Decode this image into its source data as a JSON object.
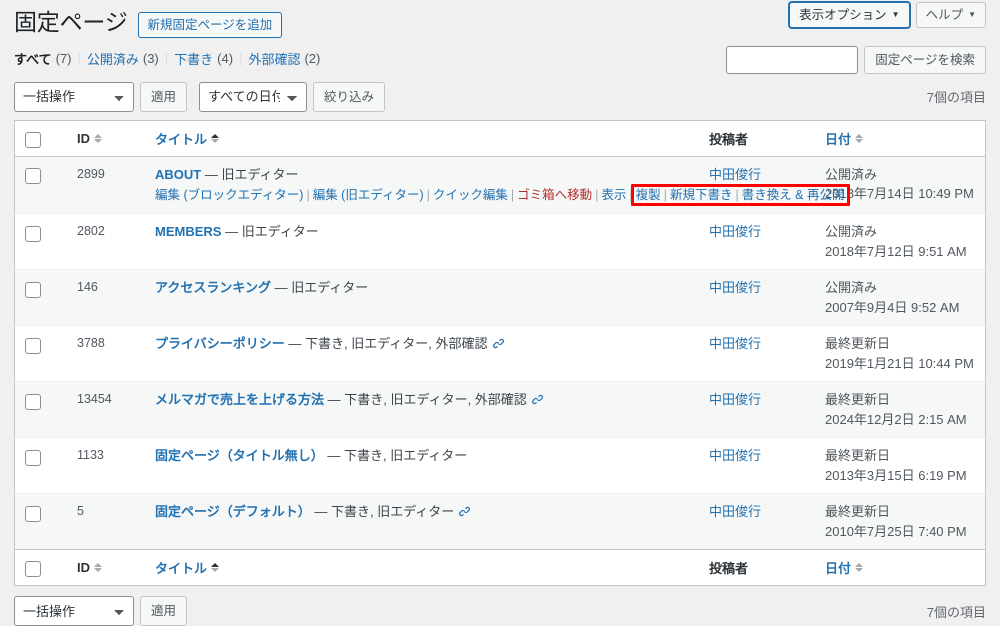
{
  "screen_meta": {
    "show_options_label": "表示オプション",
    "help_label": "ヘルプ",
    "caret": "▼"
  },
  "header": {
    "title": "固定ページ",
    "add_new_label": "新規固定ページを追加"
  },
  "status_filters": [
    {
      "label": "すべて",
      "count": "(7)",
      "current": true
    },
    {
      "label": "公開済み",
      "count": "(3)",
      "current": false
    },
    {
      "label": "下書き",
      "count": "(4)",
      "current": false
    },
    {
      "label": "外部確認",
      "count": "(2)",
      "current": false
    }
  ],
  "search": {
    "value": "",
    "placeholder": "",
    "submit_label": "固定ページを検索"
  },
  "tablenav_top": {
    "bulk_action_selected": "一括操作",
    "apply_label": "適用",
    "date_filter_selected": "すべての日付",
    "filter_label": "絞り込み",
    "displaying_num": "7個の項目"
  },
  "tablenav_bottom": {
    "bulk_action_selected": "一括操作",
    "apply_label": "適用",
    "displaying_num": "7個の項目"
  },
  "table_headers": {
    "id": "ID",
    "title": "タイトル",
    "author": "投稿者",
    "date": "日付"
  },
  "highlight": {
    "color": "#ff0000",
    "note": "複製 | 新規下書き | 書き換え & 再公開"
  },
  "colors": {
    "link": "#2271b1",
    "trash_link": "#b32d2e",
    "highlight": "#ff0000",
    "row_alt_bg": "#f6f7f7",
    "page_bg": "#f0f0f1"
  },
  "rows": [
    {
      "id": "2899",
      "title": "ABOUT",
      "state": "— 旧エディター",
      "has_link_icon": false,
      "author": "中田俊行",
      "date_status": "公開済み",
      "date_value": "2018年7月14日 10:49 PM",
      "actions": [
        {
          "label": "編集 (ブロックエディター)",
          "kind": "link"
        },
        {
          "label": "編集 (旧エディター)",
          "kind": "link"
        },
        {
          "label": "クイック編集",
          "kind": "link"
        },
        {
          "label": "ゴミ箱へ移動",
          "kind": "trash"
        },
        {
          "label": "表示",
          "kind": "link"
        },
        {
          "label": "複製",
          "kind": "link"
        },
        {
          "label": "新規下書き",
          "kind": "link"
        },
        {
          "label": "書き換え & 再公開",
          "kind": "link"
        }
      ]
    },
    {
      "id": "2802",
      "title": "MEMBERS",
      "state": "— 旧エディター",
      "has_link_icon": false,
      "author": "中田俊行",
      "date_status": "公開済み",
      "date_value": "2018年7月12日 9:51 AM",
      "actions": []
    },
    {
      "id": "146",
      "title": "アクセスランキング",
      "state": "— 旧エディター",
      "has_link_icon": false,
      "author": "中田俊行",
      "date_status": "公開済み",
      "date_value": "2007年9月4日 9:52 AM",
      "actions": []
    },
    {
      "id": "3788",
      "title": "プライバシーポリシー",
      "state": "— 下書き, 旧エディター, 外部確認",
      "has_link_icon": true,
      "author": "中田俊行",
      "date_status": "最終更新日",
      "date_value": "2019年1月21日 10:44 PM",
      "actions": []
    },
    {
      "id": "13454",
      "title": "メルマガで売上を上げる方法",
      "state": "— 下書き, 旧エディター, 外部確認",
      "has_link_icon": true,
      "author": "中田俊行",
      "date_status": "最終更新日",
      "date_value": "2024年12月2日 2:15 AM",
      "actions": []
    },
    {
      "id": "1133",
      "title": "固定ページ（タイトル無し）",
      "state": "— 下書き, 旧エディター",
      "has_link_icon": false,
      "author": "中田俊行",
      "date_status": "最終更新日",
      "date_value": "2013年3月15日 6:19 PM",
      "actions": []
    },
    {
      "id": "5",
      "title": "固定ページ（デフォルト）",
      "state": "— 下書き, 旧エディター",
      "has_link_icon": true,
      "author": "中田俊行",
      "date_status": "最終更新日",
      "date_value": "2010年7月25日 7:40 PM",
      "actions": []
    }
  ]
}
